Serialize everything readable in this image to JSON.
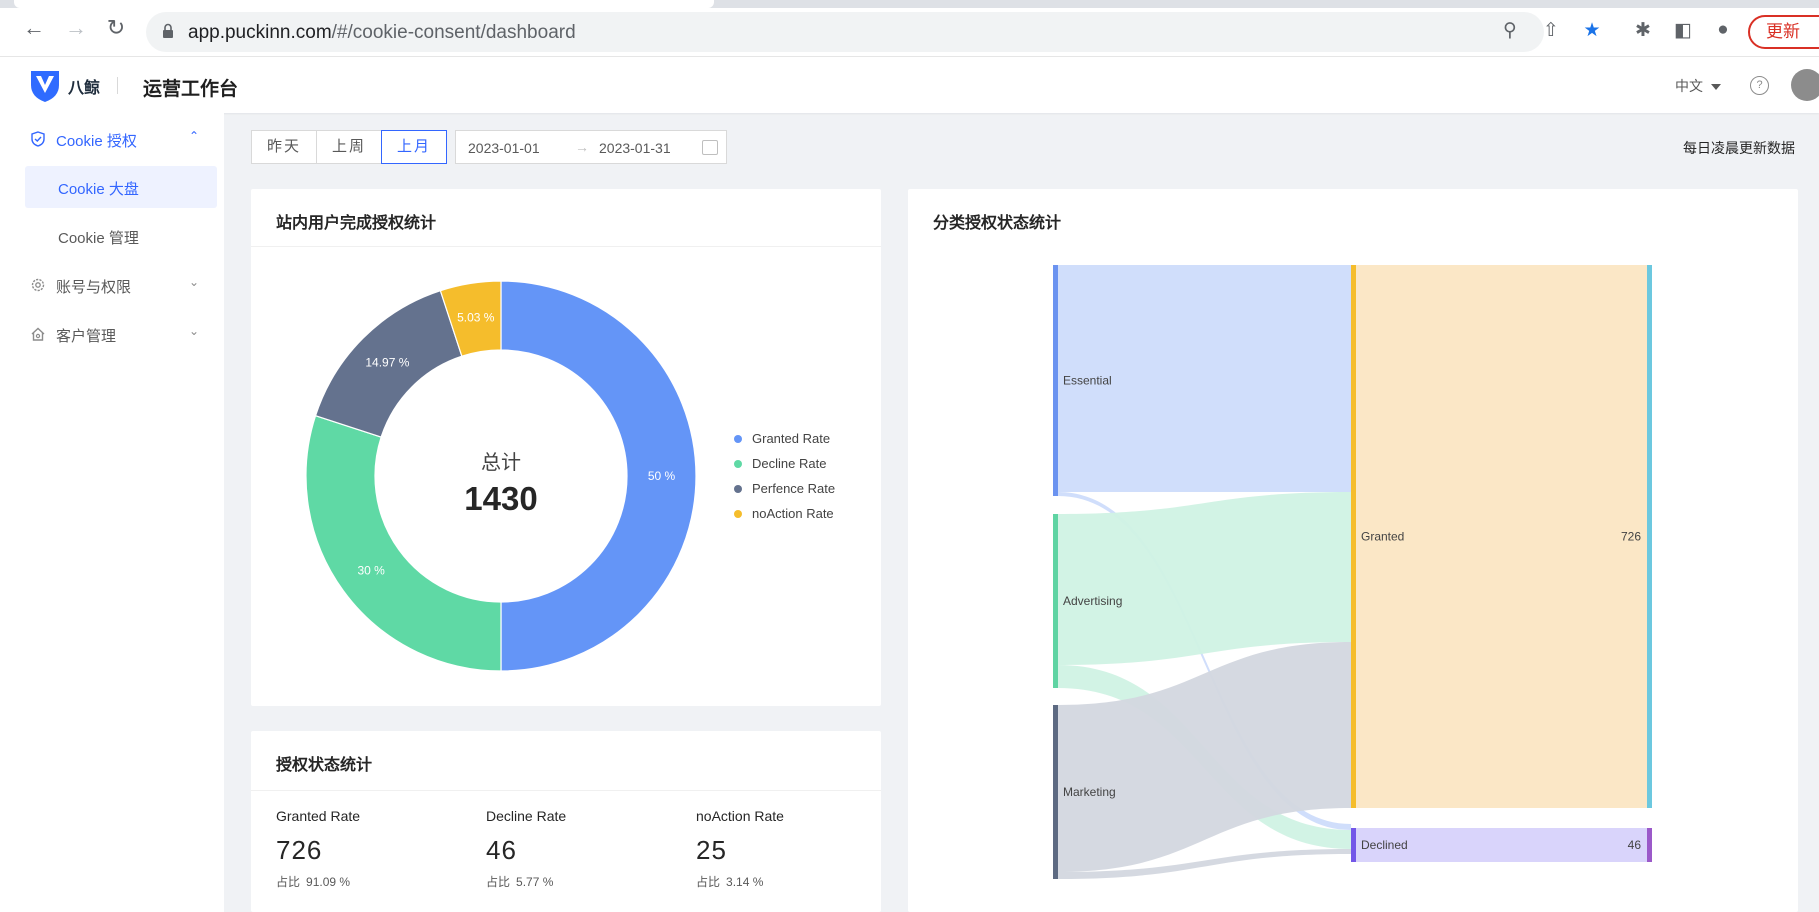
{
  "browser": {
    "url_host": "app.puckinn.com",
    "url_path": "/#/cookie-consent/dashboard",
    "update_label": "更新"
  },
  "header": {
    "brand": "八鲸",
    "title": "运营工作台",
    "language": "中文"
  },
  "sidebar": {
    "groups": [
      {
        "label": "Cookie 授权",
        "open": true,
        "children": [
          {
            "label": "Cookie 大盘",
            "active": true
          },
          {
            "label": "Cookie 管理",
            "active": false
          }
        ]
      },
      {
        "label": "账号与权限",
        "open": false
      },
      {
        "label": "客户管理",
        "open": false
      }
    ]
  },
  "toolbar": {
    "quick_ranges": [
      "昨天",
      "上周",
      "上月"
    ],
    "selected_range": "上月",
    "start_date": "2023-01-01",
    "end_date": "2023-01-31",
    "update_note": "每日凌晨更新数据"
  },
  "donut_card": {
    "title": "站内用户完成授权统计",
    "center_label": "总计",
    "center_value": "1430"
  },
  "stats_card": {
    "title": "授权状态统计",
    "ratio_prefix": "占比",
    "items": [
      {
        "label": "Granted Rate",
        "value": "726",
        "ratio": "91.09 %"
      },
      {
        "label": "Decline Rate",
        "value": "46",
        "ratio": "5.77 %"
      },
      {
        "label": "noAction Rate",
        "value": "25",
        "ratio": "3.14 %"
      }
    ]
  },
  "sankey_card": {
    "title": "分类授权状态统计"
  },
  "chart_data": [
    {
      "type": "pie",
      "style": "donut",
      "legend_position": "right",
      "slices": [
        {
          "label": "Granted Rate",
          "value": 50,
          "display": "50 %",
          "color": "#6495f7"
        },
        {
          "label": "Decline Rate",
          "value": 30,
          "display": "30 %",
          "color": "#5fd9a5"
        },
        {
          "label": "Perfence Rate",
          "value": 14.97,
          "display": "14.97 %",
          "color": "#64728e"
        },
        {
          "label": "noAction Rate",
          "value": 5.03,
          "display": "5.03 %",
          "color": "#f5bd2c"
        }
      ]
    },
    {
      "type": "sankey",
      "sources": [
        {
          "label": "Essential",
          "color": "#6b93f0",
          "fill": "#cddcfb"
        },
        {
          "label": "Advertising",
          "color": "#5fd4a3",
          "fill": "#d0f2e4"
        },
        {
          "label": "Marketing",
          "color": "#5d6a82",
          "fill": "#d3d7df"
        }
      ],
      "targets": [
        {
          "label": "Granted",
          "value": 726,
          "color": "#f5bd2c",
          "fill": "#fbe7c6",
          "edge": "#6cc8df"
        },
        {
          "label": "Declined",
          "value": 46,
          "color": "#7357e8",
          "fill": "#d9d4fb",
          "edge": "#9b59c9"
        }
      ],
      "links": [
        {
          "source": "Essential",
          "target": "Granted"
        },
        {
          "source": "Essential",
          "target": "Declined"
        },
        {
          "source": "Advertising",
          "target": "Granted"
        },
        {
          "source": "Advertising",
          "target": "Declined"
        },
        {
          "source": "Marketing",
          "target": "Granted"
        },
        {
          "source": "Marketing",
          "target": "Declined"
        }
      ]
    }
  ]
}
